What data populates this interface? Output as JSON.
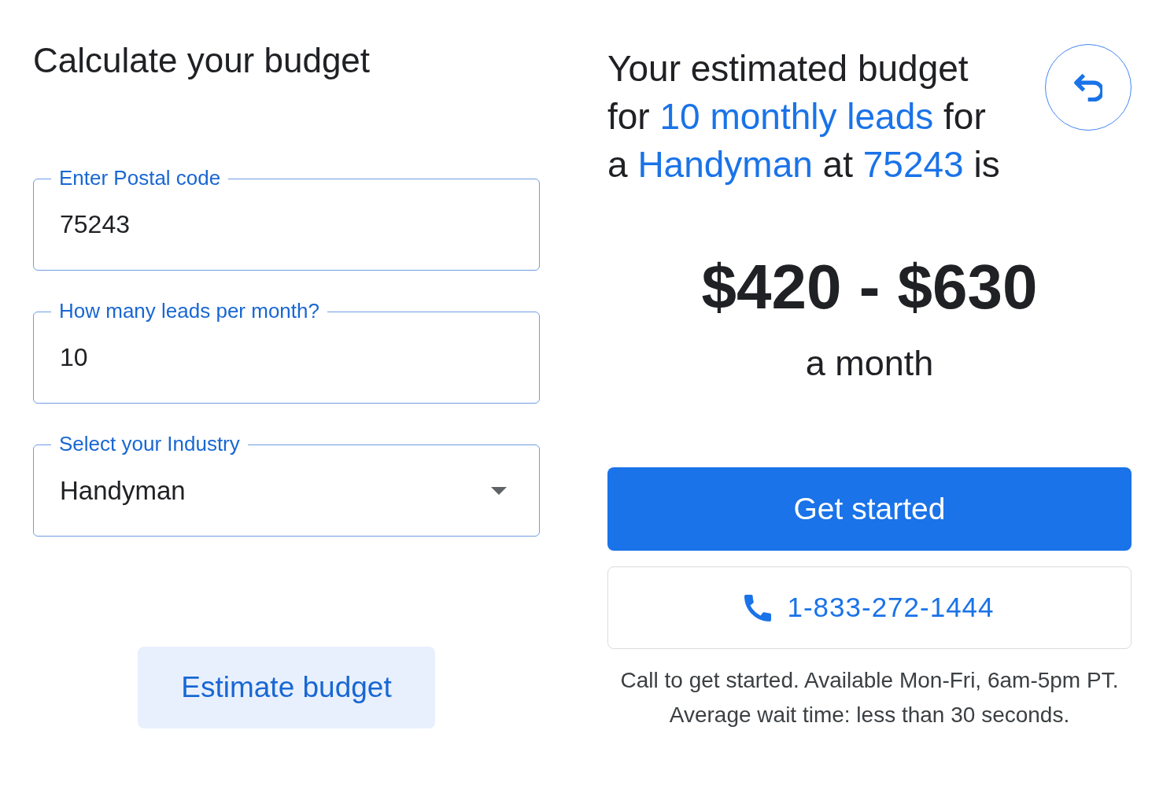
{
  "calculator": {
    "title": "Calculate your budget",
    "fields": [
      {
        "kind": "input",
        "label": "Enter Postal code",
        "value": "75243"
      },
      {
        "kind": "input",
        "label": "How many leads per month?",
        "value": "10"
      },
      {
        "kind": "select",
        "label": "Select your Industry",
        "value": "Handyman"
      }
    ],
    "submit_button": "Estimate budget"
  },
  "result": {
    "heading": [
      {
        "text": "Your estimated budget for ",
        "highlight": false
      },
      {
        "text": "10 monthly leads",
        "highlight": true
      },
      {
        "text": " for a ",
        "highlight": false
      },
      {
        "text": "Handyman",
        "highlight": true
      },
      {
        "text": " at ",
        "highlight": false
      },
      {
        "text": "75243",
        "highlight": true
      },
      {
        "text": " is",
        "highlight": false
      }
    ],
    "price": "$420 - $630",
    "period": "a month",
    "primary_button": "Get started",
    "phone_button": "1-833-272-1444",
    "note": [
      "Call to get started. Available Mon-Fri, 6am-5pm PT.",
      "Average wait time: less than 30 seconds."
    ]
  }
}
